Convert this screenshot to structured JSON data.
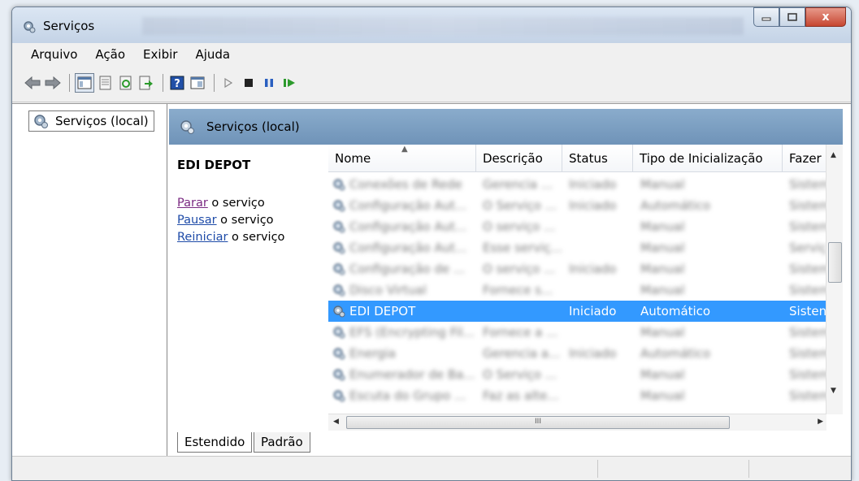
{
  "window": {
    "title": "Serviços",
    "close_glyph": "x"
  },
  "menu": [
    "Arquivo",
    "Ação",
    "Exibir",
    "Ajuda"
  ],
  "toolbar_icons": [
    "back-arrow-icon",
    "forward-arrow-icon",
    "console-tree-icon",
    "properties-icon",
    "refresh-icon",
    "export-list-icon",
    "help-icon",
    "view-icon",
    "start-icon",
    "stop-icon",
    "pause-icon",
    "resume-icon"
  ],
  "tree": {
    "item": "Serviços (local)"
  },
  "panel": {
    "header": "Serviços (local)"
  },
  "details": {
    "service_name": "EDI DEPOT",
    "actions": [
      {
        "link": "Parar",
        "suffix": " o serviço"
      },
      {
        "link": "Pausar",
        "suffix": " o serviço"
      },
      {
        "link": "Reiniciar",
        "suffix": " o serviço"
      }
    ]
  },
  "table": {
    "columns": [
      "Nome",
      "Descrição",
      "Status",
      "Tipo de Inicialização",
      "Fazer"
    ],
    "rows": [
      {
        "name": "Conexões de Rede",
        "desc": "Gerencia ...",
        "status": "Iniciado",
        "startup": "Manual",
        "logon": "Sistem",
        "blurred": true
      },
      {
        "name": "Configuração Aut...",
        "desc": "O Serviço ...",
        "status": "Iniciado",
        "startup": "Automático",
        "logon": "Sistem",
        "blurred": true
      },
      {
        "name": "Configuração Aut...",
        "desc": "O serviço ...",
        "status": "",
        "startup": "Manual",
        "logon": "Sistem",
        "blurred": true
      },
      {
        "name": "Configuração Aut...",
        "desc": "Esse serviç...",
        "status": "",
        "startup": "Manual",
        "logon": "Serviç",
        "blurred": true
      },
      {
        "name": "Configuração de ...",
        "desc": "O serviço ...",
        "status": "Iniciado",
        "startup": "Manual",
        "logon": "Sistem",
        "blurred": true
      },
      {
        "name": "Disco Virtual",
        "desc": "Fornece s...",
        "status": "",
        "startup": "Manual",
        "logon": "Sistem",
        "blurred": true
      },
      {
        "name": "EDI DEPOT",
        "desc": "",
        "status": "Iniciado",
        "startup": "Automático",
        "logon": "Sisten",
        "blurred": false
      },
      {
        "name": "EFS (Encrypting Fil...",
        "desc": "Fornece a ...",
        "status": "",
        "startup": "Manual",
        "logon": "Sistem",
        "blurred": true
      },
      {
        "name": "Energia",
        "desc": "Gerencia a...",
        "status": "Iniciado",
        "startup": "Automático",
        "logon": "Sistem",
        "blurred": true
      },
      {
        "name": "Enumerador de Ba...",
        "desc": "O Serviço ...",
        "status": "",
        "startup": "Manual",
        "logon": "Sistem",
        "blurred": true
      },
      {
        "name": "Escuta do Grupo ...",
        "desc": "Faz as alte...",
        "status": "",
        "startup": "Manual",
        "logon": "Sistem",
        "blurred": true
      }
    ],
    "selected_index": 6
  },
  "tabs": [
    "Estendido",
    "Padrão"
  ],
  "hscroll_grip": "III",
  "colors": {
    "selection": "#3399ff",
    "header_bar": "#7a9dc2",
    "link": "#1e4ba8",
    "visited_link": "#7a2a82"
  }
}
